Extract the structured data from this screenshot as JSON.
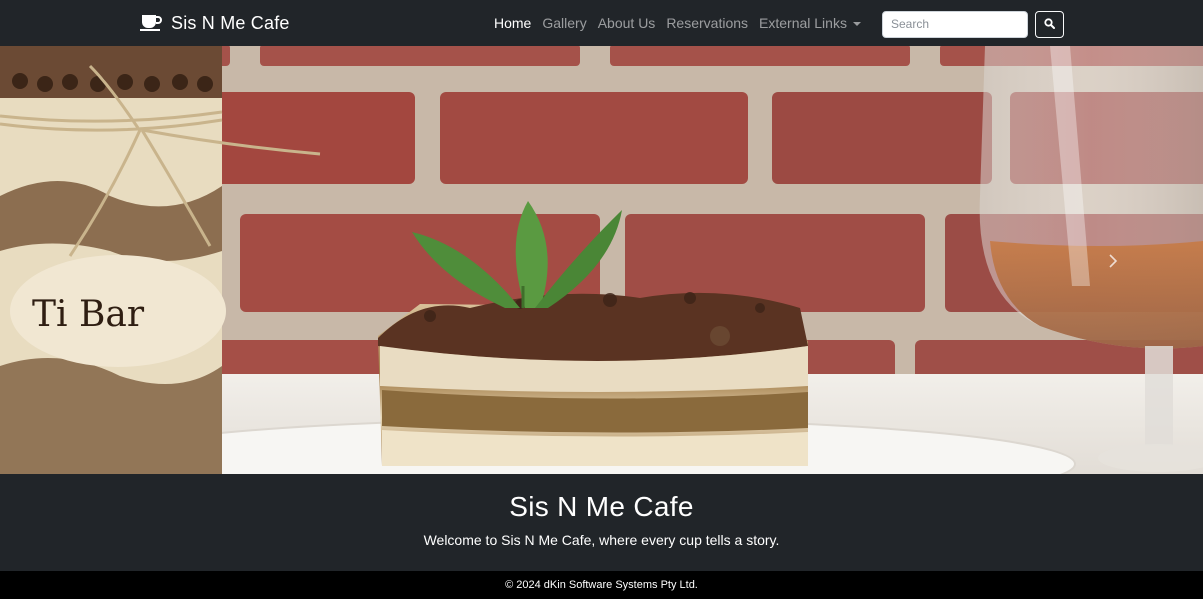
{
  "navbar": {
    "brand": {
      "icon": "coffee-cup-icon",
      "name": "Sis N Me Cafe"
    },
    "links": [
      {
        "label": "Home",
        "active": true
      },
      {
        "label": "Gallery",
        "active": false
      },
      {
        "label": "About Us",
        "active": false
      },
      {
        "label": "Reservations",
        "active": false
      }
    ],
    "dropdown": {
      "label": "External Links",
      "icon": "caret-down-icon"
    },
    "search": {
      "placeholder": "Search",
      "value": "",
      "button_icon": "search-icon"
    }
  },
  "hero": {
    "image_subject": "tiramisu-slice-photo",
    "jar_label": "Ti Bar",
    "next_icon": "chevron-right-icon"
  },
  "welcome": {
    "title": "Sis N Me Cafe",
    "tagline": "Welcome to Sis N Me Cafe, where every cup tells a story."
  },
  "footer": {
    "copyright": "© 2024 dKin Software Systems Pty Ltd."
  },
  "colors": {
    "navbar_bg": "#212529",
    "nav_active": "#ffffff",
    "nav_muted": "rgba(255,255,255,0.55)",
    "welcome_bg": "#212529",
    "footer_bg": "#000000"
  }
}
